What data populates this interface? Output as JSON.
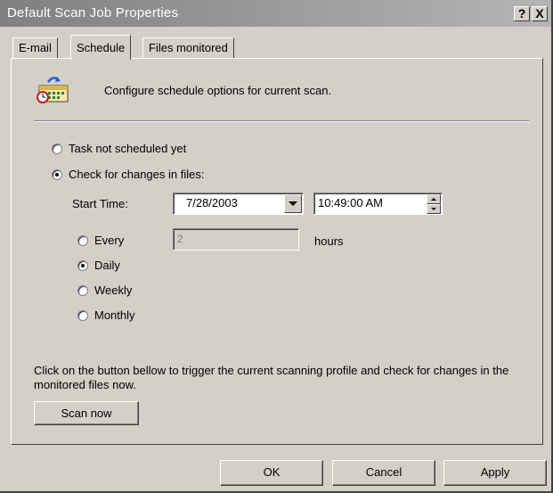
{
  "window": {
    "title": "Default Scan Job Properties",
    "help_label": "?",
    "close_label": "X"
  },
  "tabs": [
    {
      "label": "E-mail",
      "selected": false
    },
    {
      "label": "Schedule",
      "selected": true
    },
    {
      "label": "Files monitored",
      "selected": false
    }
  ],
  "header": {
    "icon": "schedule-calendar-icon",
    "text": "Configure schedule options for current scan."
  },
  "schedule": {
    "option_not_scheduled": "Task not scheduled yet",
    "option_check_changes": "Check for changes in files:",
    "selected_option": "check_changes",
    "start_time_label": "Start Time:",
    "start_date": "7/28/2003",
    "start_time": "10:49:00 AM",
    "frequency": {
      "every_label": "Every",
      "every_value": "2",
      "every_unit": "hours",
      "daily_label": "Daily",
      "weekly_label": "Weekly",
      "monthly_label": "Monthly",
      "selected": "daily"
    }
  },
  "scan_now": {
    "info_text": "Click on the button bellow to trigger the current scanning profile and check for changes in the monitored files now.",
    "button_label": "Scan now"
  },
  "footer": {
    "ok_label": "OK",
    "cancel_label": "Cancel",
    "apply_label": "Apply"
  }
}
